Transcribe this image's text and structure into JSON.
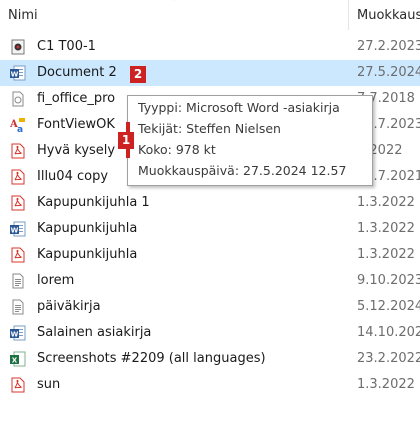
{
  "header": {
    "name_label": "Nimi",
    "modified_label": "Muokkaus"
  },
  "files": [
    {
      "name": "C1 T00-1",
      "date": "27.2.2023",
      "icon": "image-file-icon"
    },
    {
      "name": "Document 2",
      "date": "27.5.2024",
      "icon": "word-document-icon",
      "selected": true
    },
    {
      "name": "fi_office_pro",
      "date": "7.7.2018",
      "icon": "generic-file-icon"
    },
    {
      "name": "FontViewOK",
      "date": "27.7.2023",
      "icon": "application-icon"
    },
    {
      "name": "Hyvä kysely",
      "date": "4.2022",
      "icon": "pdf-file-icon"
    },
    {
      "name": "Illu04 copy",
      "date": "27.7.2021",
      "icon": "pdf-file-icon"
    },
    {
      "name": "Kapupunkijuhla 1",
      "date": "1.3.2022",
      "icon": "pdf-file-icon"
    },
    {
      "name": "Kapupunkijuhla",
      "date": "1.3.2022",
      "icon": "word-document-icon"
    },
    {
      "name": "Kapupunkijuhla",
      "date": "1.3.2022",
      "icon": "pdf-file-icon"
    },
    {
      "name": "lorem",
      "date": "9.10.2023",
      "icon": "text-file-icon"
    },
    {
      "name": "päiväkirja",
      "date": "5.12.2024",
      "icon": "text-file-icon"
    },
    {
      "name": "Salainen asiakirja",
      "date": "14.10.202",
      "icon": "word-document-icon"
    },
    {
      "name": "Screenshots #2209 (all languages)",
      "date": "23.2.2022",
      "icon": "excel-file-icon"
    },
    {
      "name": "sun",
      "date": "1.3.2022",
      "icon": "pdf-file-icon"
    }
  ],
  "tooltip": {
    "type_line": "Tyyppi: Microsoft Word -asiakirja",
    "authors_line": "Tekijät: Steffen Nielsen",
    "size_line": "Koko: 978 kt",
    "modified_line": "Muokkauspäivä: 27.5.2024 12.57"
  },
  "annotations": {
    "badge_1": "1",
    "badge_2": "2"
  },
  "colors": {
    "selection": "#cce8ff",
    "annotation_red": "#cc2222",
    "word_blue": "#2b5797",
    "pdf_red": "#d9342b",
    "excel_green": "#1e7145"
  }
}
